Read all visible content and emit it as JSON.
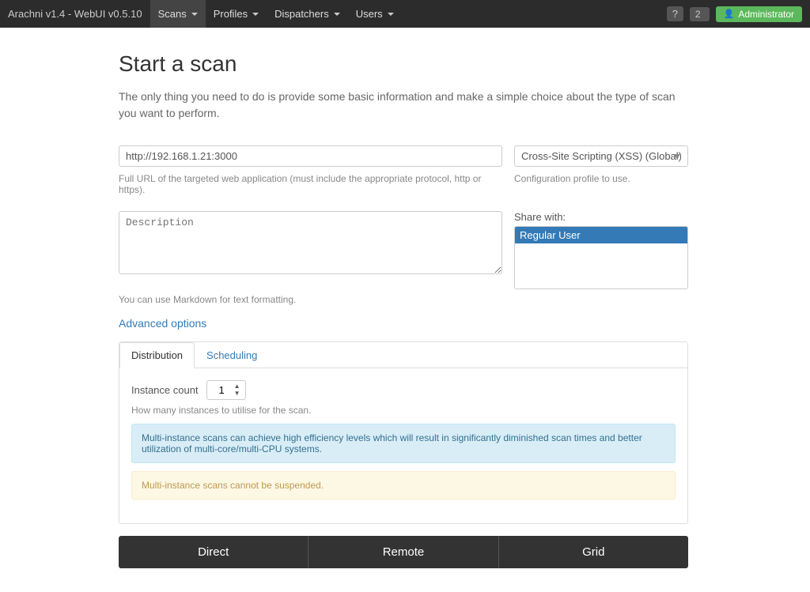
{
  "app": {
    "brand": "Arachni v1.4 - WebUI v0.5.10"
  },
  "navbar": {
    "items": [
      {
        "label": "Scans",
        "active": true
      },
      {
        "label": "Profiles"
      },
      {
        "label": "Dispatchers"
      },
      {
        "label": "Users"
      }
    ],
    "badge_icon": "?",
    "badge_count": "2",
    "admin_label": "Administrator"
  },
  "page": {
    "title": "Start a scan",
    "description": "The only thing you need to do is provide some basic information and make a simple choice about the type of scan you want to perform."
  },
  "form": {
    "url_placeholder": "http://192.168.1.21:3000",
    "url_value": "http://192.168.1.21:3000",
    "url_help": "Full URL of the targeted web application (must include the appropriate protocol, http or https).",
    "profile_value": "Cross-Site Scripting (XSS) (Global)",
    "profile_help": "Configuration profile to use.",
    "description_placeholder": "Description",
    "markdown_hint": "You can use Markdown for text formatting.",
    "share_label": "Share with:",
    "share_users": [
      {
        "label": "Regular User",
        "selected": true
      }
    ]
  },
  "advanced": {
    "link_label": "Advanced options",
    "tabs": [
      {
        "label": "Distribution",
        "active": true
      },
      {
        "label": "Scheduling",
        "active": false
      }
    ],
    "instance_label": "Instance count",
    "instance_value": "1",
    "instance_help": "How many instances to utilise for the scan.",
    "info_text": "Multi-instance scans can achieve high efficiency levels which will result in significantly diminished scan times and better utilization of multi-core/multi-CPU systems.",
    "warning_text": "Multi-instance scans cannot be suspended."
  },
  "scan_buttons": [
    {
      "label": "Direct"
    },
    {
      "label": "Remote"
    },
    {
      "label": "Grid"
    }
  ]
}
